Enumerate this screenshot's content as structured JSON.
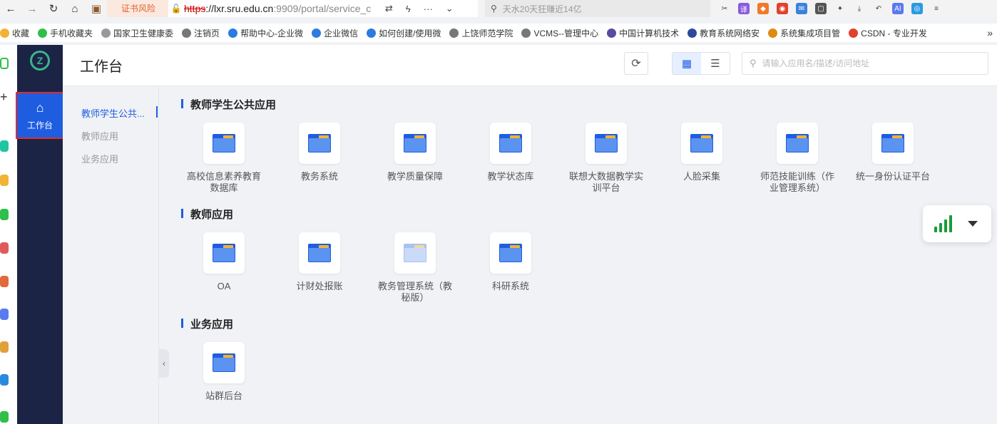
{
  "browser": {
    "cert_warning": "证书风险",
    "url": {
      "protocol": "https",
      "host": "://lxr.sru.edu.cn",
      "rest": ":9909/portal/service_c"
    },
    "search_placeholder": "天水20天狂赚近14亿",
    "bookmarks": [
      {
        "label": "收藏",
        "color": "#f2b233"
      },
      {
        "label": "手机收藏夹",
        "color": "#2fbf4a"
      },
      {
        "label": "国家卫生健康委",
        "color": "#999999"
      },
      {
        "label": "注销页",
        "color": "#777777"
      },
      {
        "label": "帮助中心-企业微",
        "color": "#2b7be0"
      },
      {
        "label": "企业微信",
        "color": "#2b7be0"
      },
      {
        "label": "如何创建/使用微",
        "color": "#2b7be0"
      },
      {
        "label": "上饶师范学院",
        "color": "#777777"
      },
      {
        "label": "VCMS--管理中心",
        "color": "#777777"
      },
      {
        "label": "中国计算机技术",
        "color": "#5a4aa0"
      },
      {
        "label": "教育系统网络安",
        "color": "#2d4a9a"
      },
      {
        "label": "系统集成项目管",
        "color": "#e08a10"
      },
      {
        "label": "CSDN - 专业开发",
        "color": "#e0422b"
      }
    ],
    "more_glyph": "»"
  },
  "app": {
    "nav": {
      "workbench_label": "工作台"
    },
    "header": {
      "title": "工作台",
      "search_placeholder": "请输入应用名/描述/访问地址"
    },
    "categories": [
      {
        "label": "教师学生公共...",
        "active": true
      },
      {
        "label": "教师应用",
        "active": false
      },
      {
        "label": "业务应用",
        "active": false
      }
    ],
    "sections": [
      {
        "title": "教师学生公共应用",
        "apps": [
          {
            "name": "高校信息素养教育\n数据库"
          },
          {
            "name": "教务系统"
          },
          {
            "name": "教学质量保障"
          },
          {
            "name": "教学状态库"
          },
          {
            "name": "联想大数据教学实\n训平台"
          },
          {
            "name": "人脸采集"
          },
          {
            "name": "师范技能训练（作\n业管理系统）"
          },
          {
            "name": "统一身份认证平台"
          }
        ]
      },
      {
        "title": "教师应用",
        "apps": [
          {
            "name": "OA"
          },
          {
            "name": "计财处报账"
          },
          {
            "name": "教务管理系统（教\n秘版）",
            "faded": true
          },
          {
            "name": "科研系统"
          }
        ]
      },
      {
        "title": "业务应用",
        "apps": [
          {
            "name": "站群后台"
          }
        ]
      }
    ]
  }
}
